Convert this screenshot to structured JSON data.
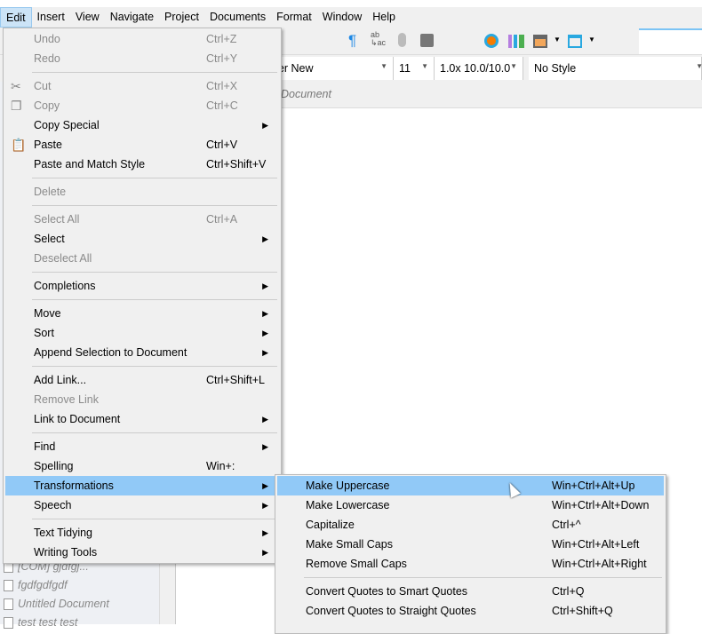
{
  "menubar": [
    "Edit",
    "Insert",
    "View",
    "Navigate",
    "Project",
    "Documents",
    "Format",
    "Window",
    "Help"
  ],
  "format": {
    "font": "rier New",
    "size": "11",
    "spacing": "1.0x 10.0/10.0",
    "style": "No Style"
  },
  "doc_header": "Document",
  "sidebar": [
    "[COM] gjdfgj...",
    "fgdfgdfgdf",
    "Untitled Document",
    "test test test"
  ],
  "edit_menu": [
    {
      "label": "Undo",
      "shortcut": "Ctrl+Z",
      "disabled": true
    },
    {
      "label": "Redo",
      "shortcut": "Ctrl+Y",
      "disabled": true
    },
    {
      "sep": true
    },
    {
      "label": "Cut",
      "shortcut": "Ctrl+X",
      "disabled": true,
      "icon": "scissors"
    },
    {
      "label": "Copy",
      "shortcut": "Ctrl+C",
      "disabled": true,
      "icon": "copy"
    },
    {
      "label": "Copy Special",
      "submenu": true
    },
    {
      "label": "Paste",
      "shortcut": "Ctrl+V",
      "icon": "paste"
    },
    {
      "label": "Paste and Match Style",
      "shortcut": "Ctrl+Shift+V"
    },
    {
      "sep": true
    },
    {
      "label": "Delete",
      "disabled": true
    },
    {
      "sep": true
    },
    {
      "label": "Select All",
      "shortcut": "Ctrl+A",
      "disabled": true
    },
    {
      "label": "Select",
      "submenu": true
    },
    {
      "label": "Deselect All",
      "disabled": true
    },
    {
      "sep": true
    },
    {
      "label": "Completions",
      "submenu": true
    },
    {
      "sep": true
    },
    {
      "label": "Move",
      "submenu": true
    },
    {
      "label": "Sort",
      "submenu": true
    },
    {
      "label": "Append Selection to Document",
      "submenu": true
    },
    {
      "sep": true
    },
    {
      "label": "Add Link...",
      "shortcut": "Ctrl+Shift+L"
    },
    {
      "label": "Remove Link",
      "disabled": true
    },
    {
      "label": "Link to Document",
      "submenu": true
    },
    {
      "sep": true
    },
    {
      "label": "Find",
      "submenu": true
    },
    {
      "label": "Spelling",
      "shortcut": "Win+:"
    },
    {
      "label": "Transformations",
      "submenu": true,
      "highlighted": true
    },
    {
      "label": "Speech",
      "submenu": true
    },
    {
      "sep": true
    },
    {
      "label": "Text Tidying",
      "submenu": true
    },
    {
      "label": "Writing Tools",
      "submenu": true
    }
  ],
  "transform_menu": [
    {
      "label": "Make Uppercase",
      "shortcut": "Win+Ctrl+Alt+Up",
      "highlighted": true
    },
    {
      "label": "Make Lowercase",
      "shortcut": "Win+Ctrl+Alt+Down"
    },
    {
      "label": "Capitalize",
      "shortcut": "Ctrl+^"
    },
    {
      "label": "Make Small Caps",
      "shortcut": "Win+Ctrl+Alt+Left"
    },
    {
      "label": "Remove Small Caps",
      "shortcut": "Win+Ctrl+Alt+Right"
    },
    {
      "sep": true
    },
    {
      "label": "Convert Quotes to Smart Quotes",
      "shortcut": "Ctrl+Q"
    },
    {
      "label": "Convert Quotes to Straight Quotes",
      "shortcut": "Ctrl+Shift+Q"
    }
  ]
}
